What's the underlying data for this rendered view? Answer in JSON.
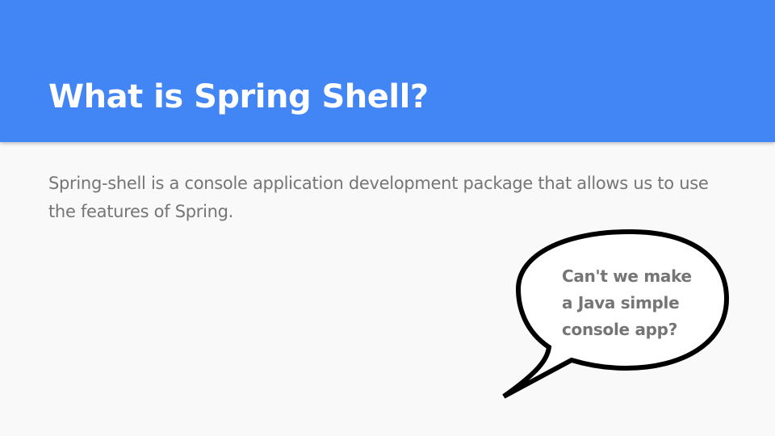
{
  "slide": {
    "title": "What is Spring Shell?",
    "body": "Spring-shell is a console application development package that allows us to use the features of Spring.",
    "callout": {
      "lines": [
        "Can't we make",
        "a Java simple",
        "console app?"
      ]
    }
  },
  "colors": {
    "header_background": "#4285f4",
    "slide_background": "#f9f9f9",
    "title_text": "#ffffff",
    "body_text": "#757575",
    "bubble_outline": "#000000",
    "bubble_fill": "#ffffff"
  }
}
